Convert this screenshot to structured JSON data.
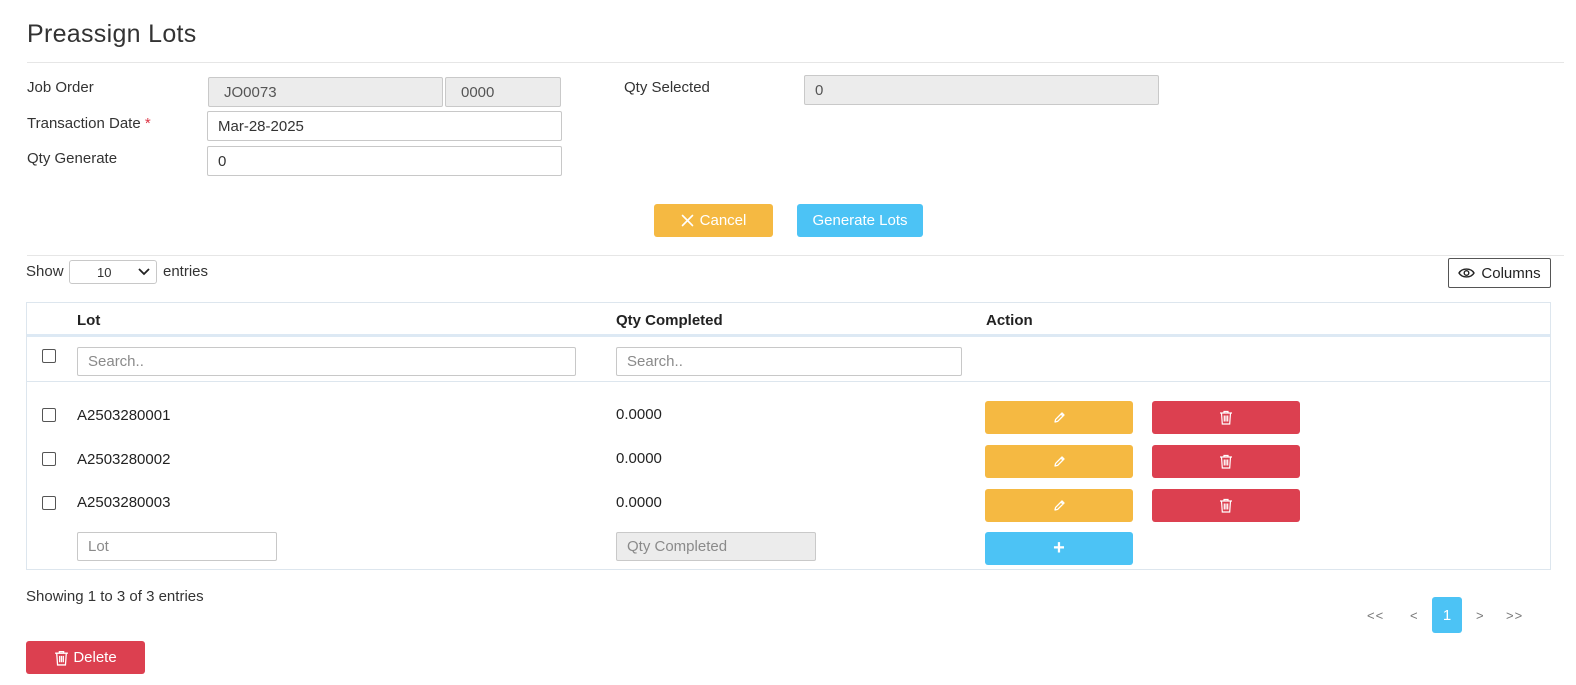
{
  "page": {
    "title": "Preassign Lots"
  },
  "form": {
    "job_order_label": "Job Order",
    "job_order_value": "JO0073",
    "job_order_seq": "0000",
    "transaction_date_label": "Transaction Date",
    "required_mark": "*",
    "transaction_date_value": "Mar-28-2025",
    "qty_generate_label": "Qty Generate",
    "qty_generate_value": "0",
    "qty_selected_label": "Qty Selected",
    "qty_selected_value": "0"
  },
  "actions": {
    "cancel_label": "Cancel",
    "generate_label": "Generate Lots"
  },
  "table_controls": {
    "show_label": "Show",
    "page_size": "10",
    "entries_label": "entries",
    "columns_label": "Columns"
  },
  "table": {
    "headers": {
      "lot": "Lot",
      "qty_completed": "Qty Completed",
      "action": "Action"
    },
    "search_placeholder": "Search..",
    "rows": [
      {
        "lot": "A2503280001",
        "qty_completed": "0.0000"
      },
      {
        "lot": "A2503280002",
        "qty_completed": "0.0000"
      },
      {
        "lot": "A2503280003",
        "qty_completed": "0.0000"
      }
    ],
    "new_row": {
      "lot_placeholder": "Lot",
      "qty_placeholder": "Qty Completed",
      "add_label": "+"
    }
  },
  "footer": {
    "info": "Showing 1 to 3 of 3 entries",
    "delete_label": "Delete",
    "pagination": {
      "first": "<<",
      "prev": "<",
      "current": "1",
      "next": ">",
      "last": ">>"
    }
  },
  "colors": {
    "warning": "#f5b942",
    "info": "#4cc3f5",
    "danger": "#dc4050"
  },
  "icons": {
    "cancel": "close-icon",
    "edit": "pencil-icon",
    "delete": "trash-icon",
    "columns": "eye-icon",
    "select": "chevron-down-icon"
  }
}
